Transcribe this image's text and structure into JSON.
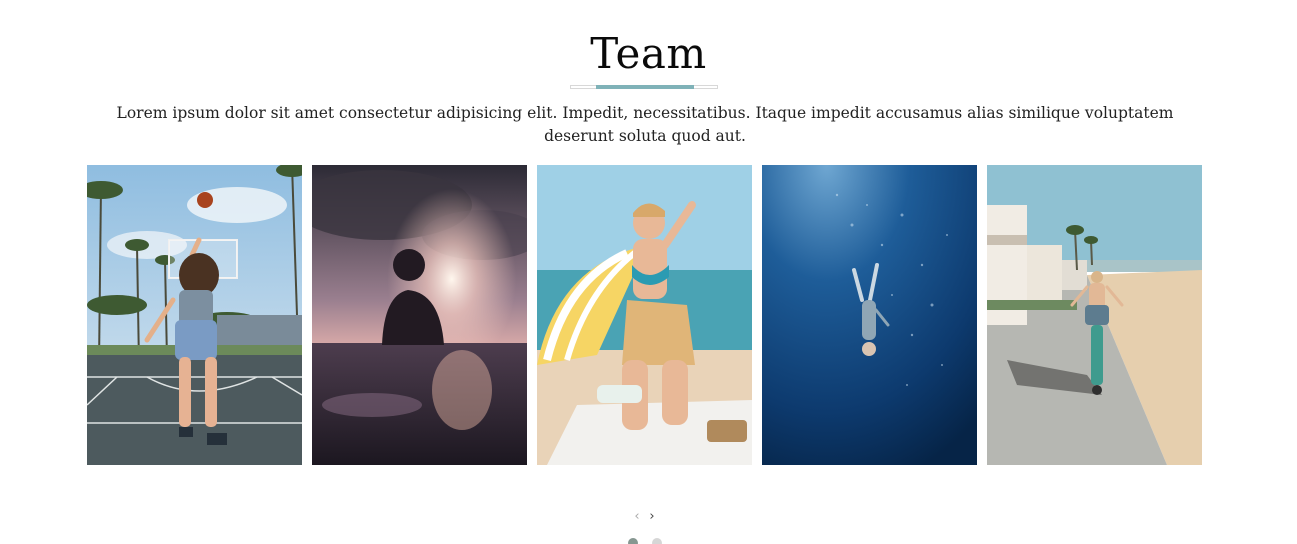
{
  "section": {
    "title": "Team",
    "description": "Lorem ipsum dolor sit amet consectetur adipisicing elit. Impedit, necessitatibus. Itaque impedit accusamus alias similique voluptatem deserunt soluta quod aut."
  },
  "colors": {
    "accent": "#7fb2b8",
    "dot_active": "#869791",
    "dot_inactive": "#d6d6d6"
  },
  "gallery": {
    "items": [
      {
        "icon": "photo-basketball-player"
      },
      {
        "icon": "photo-sunset-swimmer"
      },
      {
        "icon": "photo-beach-woman"
      },
      {
        "icon": "photo-underwater-diver"
      },
      {
        "icon": "photo-beach-cyclist"
      }
    ]
  },
  "carousel": {
    "prev_label": "‹",
    "next_label": "›",
    "current_slide": 1,
    "total_slides": 2
  }
}
